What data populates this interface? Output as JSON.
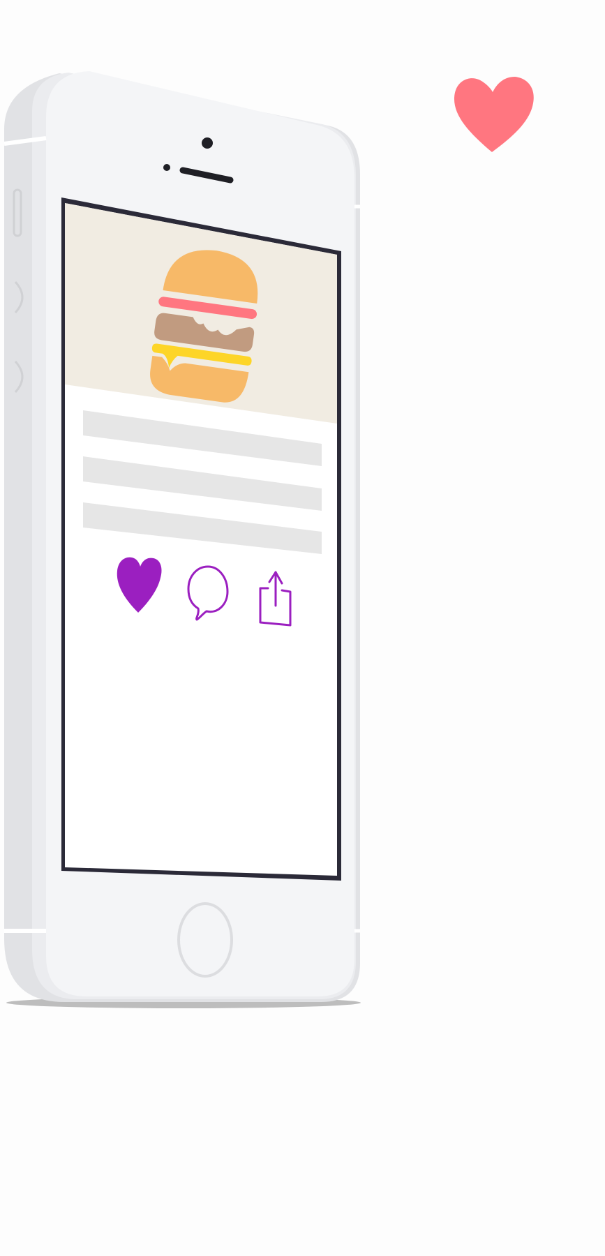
{
  "colors": {
    "page_background": "#fdfdfd",
    "phone_body": "#f4f5f7",
    "phone_edge": "#e1e2e5",
    "screen_bezel": "#2b2a38",
    "hero_background": "#f1ece2",
    "content_background": "#ffffff",
    "text_placeholder": "#e6e6e6",
    "accent_purple": "#9b1fc0",
    "floating_heart": "#ff7680",
    "bun": "#f7b968",
    "tomato": "#ff7680",
    "patty": "#c19b80",
    "cheese": "#fdd528"
  },
  "screen": {
    "hero_image": "burger-illustration",
    "text_placeholder_lines": 3,
    "actions": [
      {
        "name": "like",
        "icon": "heart-icon",
        "state": "liked"
      },
      {
        "name": "comment",
        "icon": "speech-bubble-icon",
        "state": "default"
      },
      {
        "name": "share",
        "icon": "share-icon",
        "state": "default"
      }
    ]
  },
  "decorations": {
    "floating_heart_icon": "heart-icon"
  }
}
